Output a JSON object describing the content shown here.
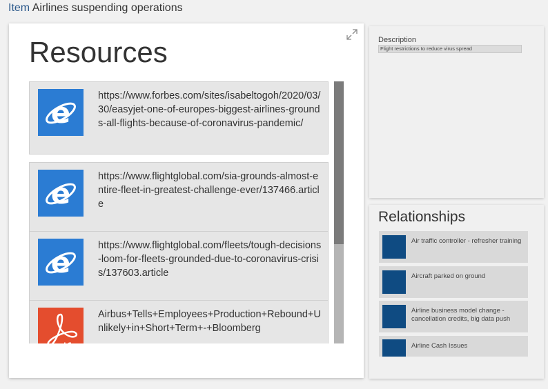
{
  "header": {
    "prefix": "Item",
    "title": "Airlines suspending operations"
  },
  "resources": {
    "title": "Resources",
    "items": [
      {
        "type": "web",
        "icon": "internet-explorer-icon",
        "text": "https://www.forbes.com/sites/isabeltogoh/2020/03/30/easyjet-one-of-europes-biggest-airlines-grounds-all-flights-because-of-coronavirus-pandemic/"
      },
      {
        "type": "web",
        "icon": "internet-explorer-icon",
        "text": "https://www.flightglobal.com/sia-grounds-almost-entire-fleet-in-greatest-challenge-ever/137466.article"
      },
      {
        "type": "web",
        "icon": "internet-explorer-icon",
        "text": "https://www.flightglobal.com/fleets/tough-decisions-loom-for-fleets-grounded-due-to-coronavirus-crisis/137603.article"
      },
      {
        "type": "pdf",
        "icon": "pdf-icon",
        "text": "Airbus+Tells+Employees+Production+Rebound+Unlikely+in+Short+Term+-+Bloomberg"
      }
    ]
  },
  "description": {
    "label": "Description",
    "value": "Flight restrictions to reduce virus spread"
  },
  "relationships": {
    "title": "Relationships",
    "items": [
      {
        "label": "Air traffic controller - refresher training"
      },
      {
        "label": "Aircraft parked on ground"
      },
      {
        "label": "Airline business model change - cancellation credits, big data push"
      },
      {
        "label": "Airline Cash Issues"
      }
    ]
  },
  "colors": {
    "accent": "#2d5a8c",
    "ie_blue": "#2b7cd3",
    "pdf_red": "#e44d2e",
    "thumb_navy": "#0f4b82"
  }
}
